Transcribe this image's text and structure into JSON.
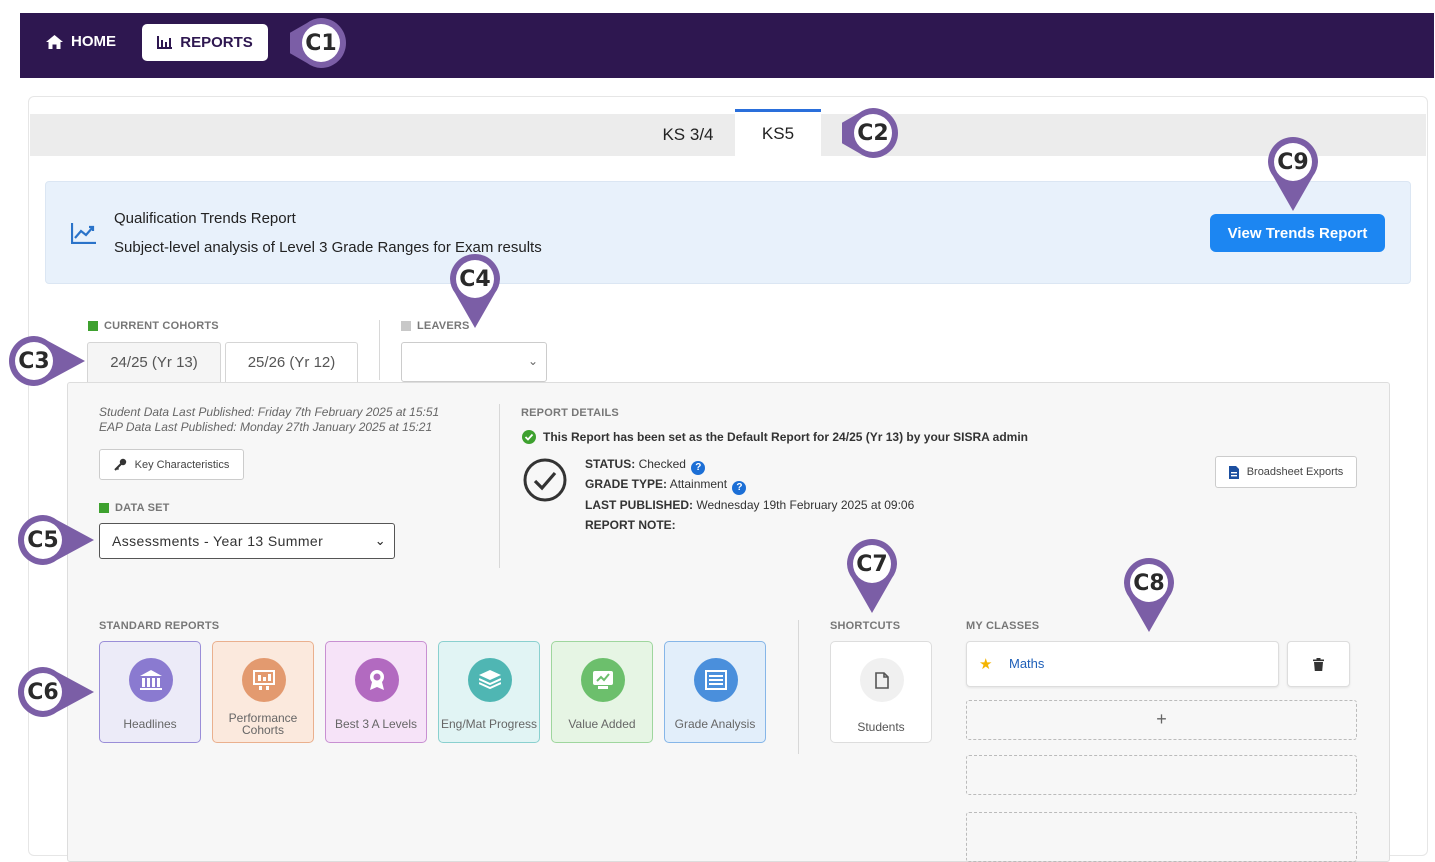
{
  "nav": {
    "home_label": "HOME",
    "reports_label": "REPORTS"
  },
  "tabs": [
    {
      "label": "KS 3/4",
      "active": false
    },
    {
      "label": "KS5",
      "active": true
    }
  ],
  "banner": {
    "title": "Qualification Trends Report",
    "subtitle": "Subject-level analysis of Level 3 Grade Ranges for Exam results",
    "button_label": "View Trends Report"
  },
  "cohorts": {
    "current_label": "CURRENT COHORTS",
    "leavers_label": "LEAVERS",
    "tabs": [
      "24/25 (Yr 13)",
      "25/26 (Yr 12)"
    ],
    "leavers_value": ""
  },
  "meta": {
    "student_published": "Student Data Last Published: Friday 7th February 2025 at 15:51",
    "eap_published": "EAP Data Last Published: Monday 27th January 2025 at 15:21",
    "key_characteristics": "Key Characteristics",
    "dataset_label": "DATA SET",
    "dataset_value": "Assessments - Year 13 Summer"
  },
  "report_details": {
    "heading": "REPORT DETAILS",
    "default_notice": "This Report has been set as the Default Report for 24/25 (Yr 13) by your SISRA admin",
    "status_key": "STATUS:",
    "status_value": "Checked",
    "grade_type_key": "GRADE TYPE:",
    "grade_type_value": "Attainment",
    "last_published_key": "LAST PUBLISHED:",
    "last_published_value": "Wednesday 19th February 2025 at 09:06",
    "report_note_key": "REPORT NOTE:",
    "broadsheet_label": "Broadsheet Exports"
  },
  "standard_reports": {
    "heading": "STANDARD REPORTS",
    "items": [
      {
        "label": "Headlines",
        "color": "#8a7ad0",
        "bg": "#ecebf8",
        "border": "#9a8ed8"
      },
      {
        "label": "Performance Cohorts",
        "color": "#e39a6f",
        "bg": "#fbe9dd",
        "border": "#eab08e"
      },
      {
        "label": "Best 3 A Levels",
        "color": "#b26ac0",
        "bg": "#f6e3f8",
        "border": "#c890d2"
      },
      {
        "label": "Eng/Mat Progress",
        "color": "#4fb6b3",
        "bg": "#e1f4f4",
        "border": "#8ad0cf"
      },
      {
        "label": "Value Added",
        "color": "#6cbf6c",
        "bg": "#e6f5e4",
        "border": "#9fd69e"
      },
      {
        "label": "Grade Analysis",
        "color": "#4a8fdc",
        "bg": "#e2eefa",
        "border": "#86b6e8"
      }
    ]
  },
  "shortcuts": {
    "heading": "SHORTCUTS",
    "items": [
      {
        "label": "Students"
      }
    ]
  },
  "my_classes": {
    "heading": "MY CLASSES",
    "items": [
      {
        "name": "Maths"
      }
    ],
    "add_label": "+"
  },
  "callouts": [
    "C1",
    "C2",
    "C3",
    "C4",
    "C5",
    "C6",
    "C7",
    "C8",
    "C9"
  ],
  "colors": {
    "topbar": "#2e1750",
    "accent_blue": "#1c86f2",
    "callout_purple": "#7b5ea6"
  }
}
